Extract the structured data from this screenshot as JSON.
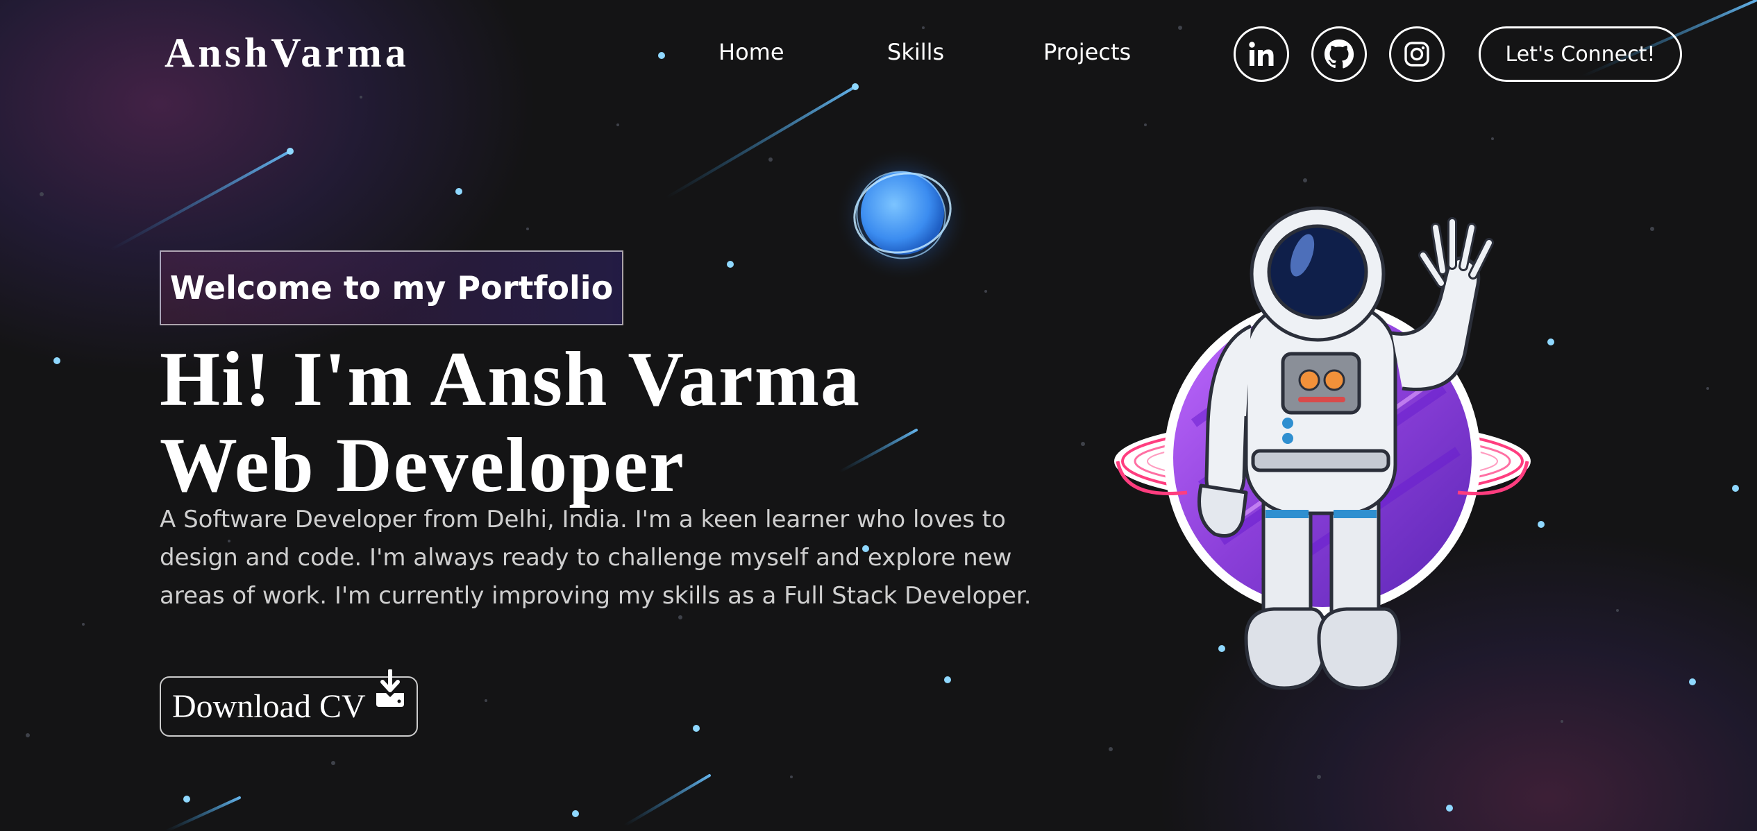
{
  "header": {
    "logo": "AnshVarma",
    "nav": [
      {
        "label": "Home"
      },
      {
        "label": "Skills"
      },
      {
        "label": "Projects"
      }
    ],
    "social": [
      {
        "icon": "linkedin-icon"
      },
      {
        "icon": "github-icon"
      },
      {
        "icon": "instagram-icon"
      }
    ],
    "connect_label": "Let's Connect!"
  },
  "hero": {
    "tagline": "Welcome to my Portfolio",
    "headline_line1": "Hi! I'm Ansh Varma",
    "headline_line2": "Web Developer",
    "bio": "A Software Developer from Delhi, India. I'm a keen learner who loves to design and code. I'm always ready to challenge myself and explore new areas of work. I'm currently improving my skills as a Full Stack Developer.",
    "download_label": "Download CV",
    "download_icon": "download-icon"
  },
  "colors": {
    "background": "#141415",
    "text": "#ffffff",
    "muted_text": "#cfcfcf",
    "orb": "#3d9bff",
    "planet": "#8b3fd9",
    "ring": "#ff3d7f"
  }
}
